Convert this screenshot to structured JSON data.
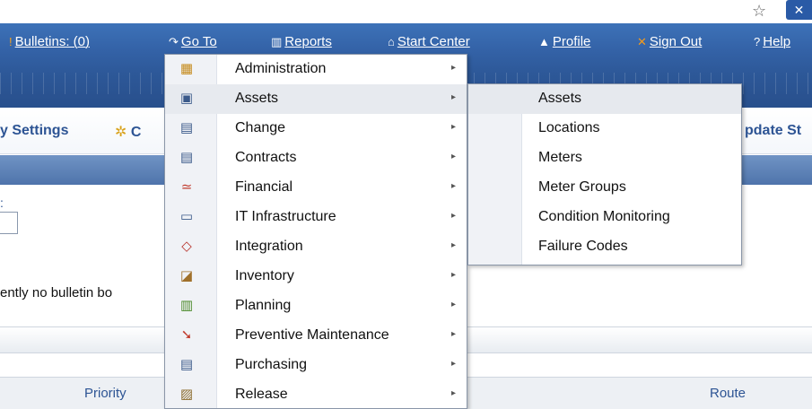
{
  "chrome": {
    "star_icon": "star-icon",
    "button_icon": "x-icon"
  },
  "nav": {
    "bulletins": "Bulletins: (0)",
    "goto": "Go To",
    "reports": "Reports",
    "start_center": "Start Center",
    "profile": "Profile",
    "sign_out": "Sign Out",
    "help": "Help"
  },
  "toolbar": {
    "left_text": "y Settings",
    "middle_text": "C",
    "right_text": "pdate St"
  },
  "body": {
    "small_label": ":",
    "bulletin_text": "ently no bulletin bo",
    "col_priority": "Priority",
    "col_route": "Route"
  },
  "menu": {
    "items": [
      {
        "label": "Administration",
        "icon": "administration-icon"
      },
      {
        "label": "Assets",
        "icon": "assets-icon"
      },
      {
        "label": "Change",
        "icon": "change-icon"
      },
      {
        "label": "Contracts",
        "icon": "contracts-icon"
      },
      {
        "label": "Financial",
        "icon": "financial-icon"
      },
      {
        "label": "IT Infrastructure",
        "icon": "it-infrastructure-icon"
      },
      {
        "label": "Integration",
        "icon": "integration-icon"
      },
      {
        "label": "Inventory",
        "icon": "inventory-icon"
      },
      {
        "label": "Planning",
        "icon": "planning-icon"
      },
      {
        "label": "Preventive Maintenance",
        "icon": "preventive-maintenance-icon"
      },
      {
        "label": "Purchasing",
        "icon": "purchasing-icon"
      },
      {
        "label": "Release",
        "icon": "release-icon"
      }
    ]
  },
  "submenu": {
    "items": [
      {
        "label": "Assets"
      },
      {
        "label": "Locations"
      },
      {
        "label": "Meters"
      },
      {
        "label": "Meter Groups"
      },
      {
        "label": "Condition Monitoring"
      },
      {
        "label": "Failure Codes"
      }
    ]
  },
  "colors": {
    "header_blue": "#2d5898",
    "link_blue": "#2d5494",
    "menu_highlight": "#e7eaef"
  }
}
